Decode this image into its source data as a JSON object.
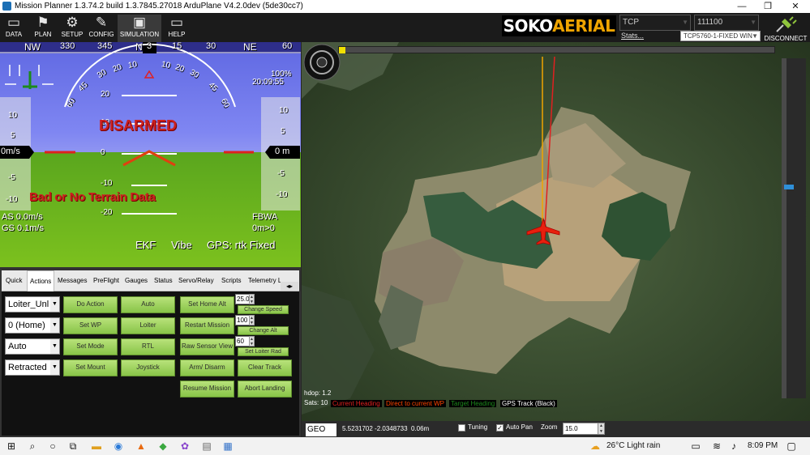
{
  "window": {
    "title": "Mission Planner 1.3.74.2 build 1.3.7845.27018 ArduPlane V4.2.0dev (5de30cc7)",
    "min_symbol": "—",
    "max_symbol": "❐",
    "close_symbol": "✕"
  },
  "menu": [
    {
      "label": "DATA",
      "icon": "monitor-icon",
      "glyph": "▭"
    },
    {
      "label": "PLAN",
      "icon": "plan-icon",
      "glyph": "⚑"
    },
    {
      "label": "SETUP",
      "icon": "setup-gear-icon",
      "glyph": "⚙"
    },
    {
      "label": "CONFIG",
      "icon": "config-wrench-icon",
      "glyph": "✎"
    },
    {
      "label": "SIMULATION",
      "icon": "simulation-monitor-icon",
      "glyph": "▣"
    },
    {
      "label": "HELP",
      "icon": "help-monitor-icon",
      "glyph": "▭"
    }
  ],
  "brand": {
    "part1": "SOKO",
    "part2": "AERIAL"
  },
  "connection": {
    "type": "TCP",
    "baud": "111100",
    "stats_link": "Stats...",
    "port": "TCP5760-1-FIXED WIN",
    "disconnect_label": "DISCONNECT"
  },
  "hud": {
    "heading_tape": [
      "NW",
      "330",
      "345",
      "N",
      "3",
      "15",
      "30",
      "NE",
      "60"
    ],
    "heading_value": "3",
    "battery": "100%",
    "clock": "20:09:55",
    "status": "DISARMED",
    "warning": "Bad or No Terrain Data",
    "speed_box": "0m/s",
    "alt_box": "0 m",
    "speed_ticks": [
      "10",
      "5",
      "-5",
      "-10"
    ],
    "alt_ticks": [
      "10",
      "5",
      "-5",
      "-10"
    ],
    "pitch_labels": [
      "20",
      "10",
      "0",
      "-10",
      "-20"
    ],
    "roll_labels": [
      "60",
      "45",
      "30",
      "20",
      "10",
      "0",
      "10",
      "20",
      "30",
      "45",
      "60"
    ],
    "airspeed": "AS 0.0m/s",
    "groundspeed": "GS 0.1m/s",
    "mode": "FBWA",
    "wp": "0m>0",
    "ekf": "EKF",
    "vibe": "Vibe",
    "gps": "GPS: rtk Fixed",
    "colors": {
      "sky": "#7f86f2",
      "ground": "#7cc11e",
      "warning": "#cc2020"
    }
  },
  "tabs": [
    "Quick",
    "Actions",
    "Messages",
    "PreFlight",
    "Gauges",
    "Status",
    "Servo/Relay",
    "Scripts",
    "Telemetry L"
  ],
  "selected_tab": "Actions",
  "actions": {
    "dropdowns": [
      "Loiter_Unl",
      "0 (Home)",
      "Auto",
      "Retracted"
    ],
    "buttons": {
      "do_action": "Do Action",
      "auto": "Auto",
      "set_home_alt": "Set Home Alt",
      "set_wp": "Set WP",
      "loiter": "Loiter",
      "restart_mission": "Restart Mission",
      "set_mode": "Set Mode",
      "rtl": "RTL",
      "raw_sensor_view": "Raw Sensor View",
      "set_mount": "Set Mount",
      "joystick": "Joystick",
      "arm_disarm": "Arm/ Disarm",
      "clear_track": "Clear Track",
      "resume_mission": "Resume Mission",
      "abort_landing": "Abort Landing",
      "change_speed": "Change Speed",
      "change_alt": "Change Alt",
      "set_loiter_rad": "Set Loiter Rad"
    },
    "numeric": {
      "speed": "25.0",
      "alt": "100",
      "loiter_rad": "60"
    }
  },
  "map": {
    "hdop": "hdop: 1.2",
    "sats": "Sats: 10",
    "legend": [
      {
        "label": "Current Heading",
        "color": "#e02020"
      },
      {
        "label": "Direct to current WP",
        "color": "#ff4400"
      },
      {
        "label": "Target Heading",
        "color": "#1c8a1c"
      },
      {
        "label": "GPS Track (Black)",
        "color": "#ffffff"
      }
    ],
    "coord_system": "GEO",
    "coords": "5.5231702 -2.0348733",
    "alt": "0.06m",
    "tuning_label": "Tuning",
    "tuning_checked": false,
    "autopan_label": "Auto Pan",
    "autopan_checked": true,
    "zoom_label": "Zoom",
    "zoom_value": "15.0"
  },
  "taskbar": {
    "weather": "26°C  Light rain",
    "time": "8:09 PM"
  }
}
